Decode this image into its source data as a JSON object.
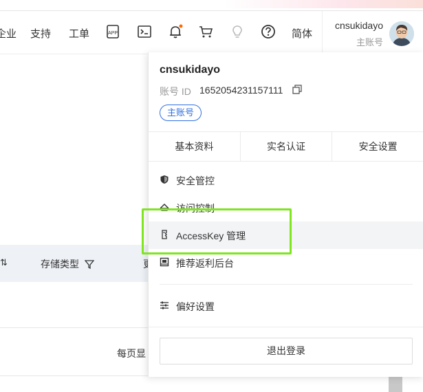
{
  "header": {
    "nav": [
      "企业",
      "支持",
      "工单"
    ],
    "lang": "简体",
    "username": "cnsukidayo",
    "role": "主账号",
    "icons": [
      "app-icon",
      "terminal-icon",
      "bell-icon",
      "cart-icon",
      "bulb-icon",
      "help-icon"
    ],
    "accent": "#ff6a00"
  },
  "background": {
    "table_headers": [
      "存储类型"
    ],
    "table_partial_header": "更",
    "pagination_text": "每页显"
  },
  "dropdown": {
    "name": "cnsukidayo",
    "id_label": "账号 ID",
    "id_value": "1652054231157111",
    "badge": "主账号",
    "tabs": [
      "基本资料",
      "实名认证",
      "安全设置"
    ],
    "menu": [
      {
        "label": "安全管控",
        "icon": "shield-icon"
      },
      {
        "label": "访问控制",
        "icon": "access-control-icon"
      },
      {
        "label": "AccessKey 管理",
        "icon": "key-icon"
      },
      {
        "label": "推荐返利后台",
        "icon": "rebate-icon"
      },
      {
        "label": "偏好设置",
        "icon": "sliders-icon"
      }
    ],
    "logout": "退出登录"
  },
  "colors": {
    "badge_blue": "#2f6fe0",
    "highlight_green": "#7ee51f",
    "notification_dot": "#ff6a00"
  }
}
